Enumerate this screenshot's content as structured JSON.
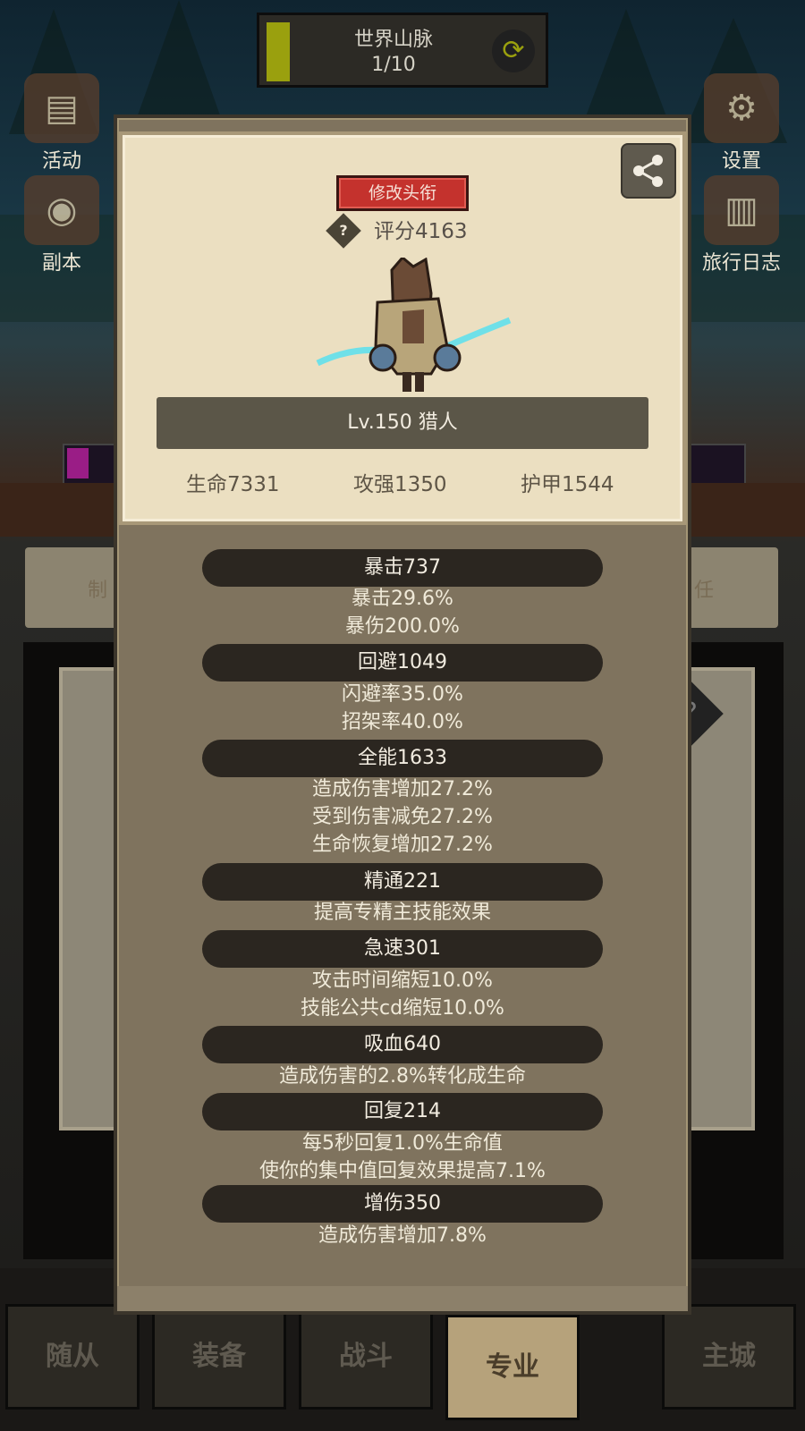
{
  "background": {
    "map_title": "世界山脉",
    "map_progress": "1/10",
    "map_progress_fraction": 0.1,
    "left_buttons": [
      "活动",
      "副本"
    ],
    "right_buttons": [
      "设置",
      "旅行日志"
    ],
    "side_text_left": "制",
    "side_text_right": "任",
    "question_glyph": "?",
    "bottom_tabs": [
      "随从",
      "装备",
      "战斗",
      "专业",
      "主城"
    ],
    "active_tab": "专业"
  },
  "profile": {
    "title_button": "修改头衔",
    "help_glyph": "?",
    "score": "评分4163",
    "level_class": "Lv.150 猎人",
    "stats": [
      "生命7331",
      "攻强1350",
      "护甲1544"
    ]
  },
  "details": [
    {
      "header": "暴击737",
      "lines": [
        "暴击29.6%",
        "暴伤200.0%"
      ]
    },
    {
      "header": "回避1049",
      "lines": [
        "闪避率35.0%",
        "招架率40.0%"
      ]
    },
    {
      "header": "全能1633",
      "lines": [
        "造成伤害增加27.2%",
        "受到伤害减免27.2%",
        "生命恢复增加27.2%"
      ]
    },
    {
      "header": "精通221",
      "lines": [
        "提高专精主技能效果"
      ]
    },
    {
      "header": "急速301",
      "lines": [
        "攻击时间缩短10.0%",
        "技能公共cd缩短10.0%"
      ]
    },
    {
      "header": "吸血640",
      "lines": [
        "造成伤害的2.8%转化成生命"
      ]
    },
    {
      "header": "回复214",
      "lines": [
        "每5秒回复1.0%生命值",
        "使你的集中值回复效果提高7.1%"
      ]
    },
    {
      "header": "增伤350",
      "lines": [
        "造成伤害增加7.8%"
      ]
    }
  ],
  "colors": {
    "accent_red": "#c4322d",
    "parchment": "#ebdfc1",
    "panel": "#7f735e",
    "pill": "#2b2620"
  }
}
